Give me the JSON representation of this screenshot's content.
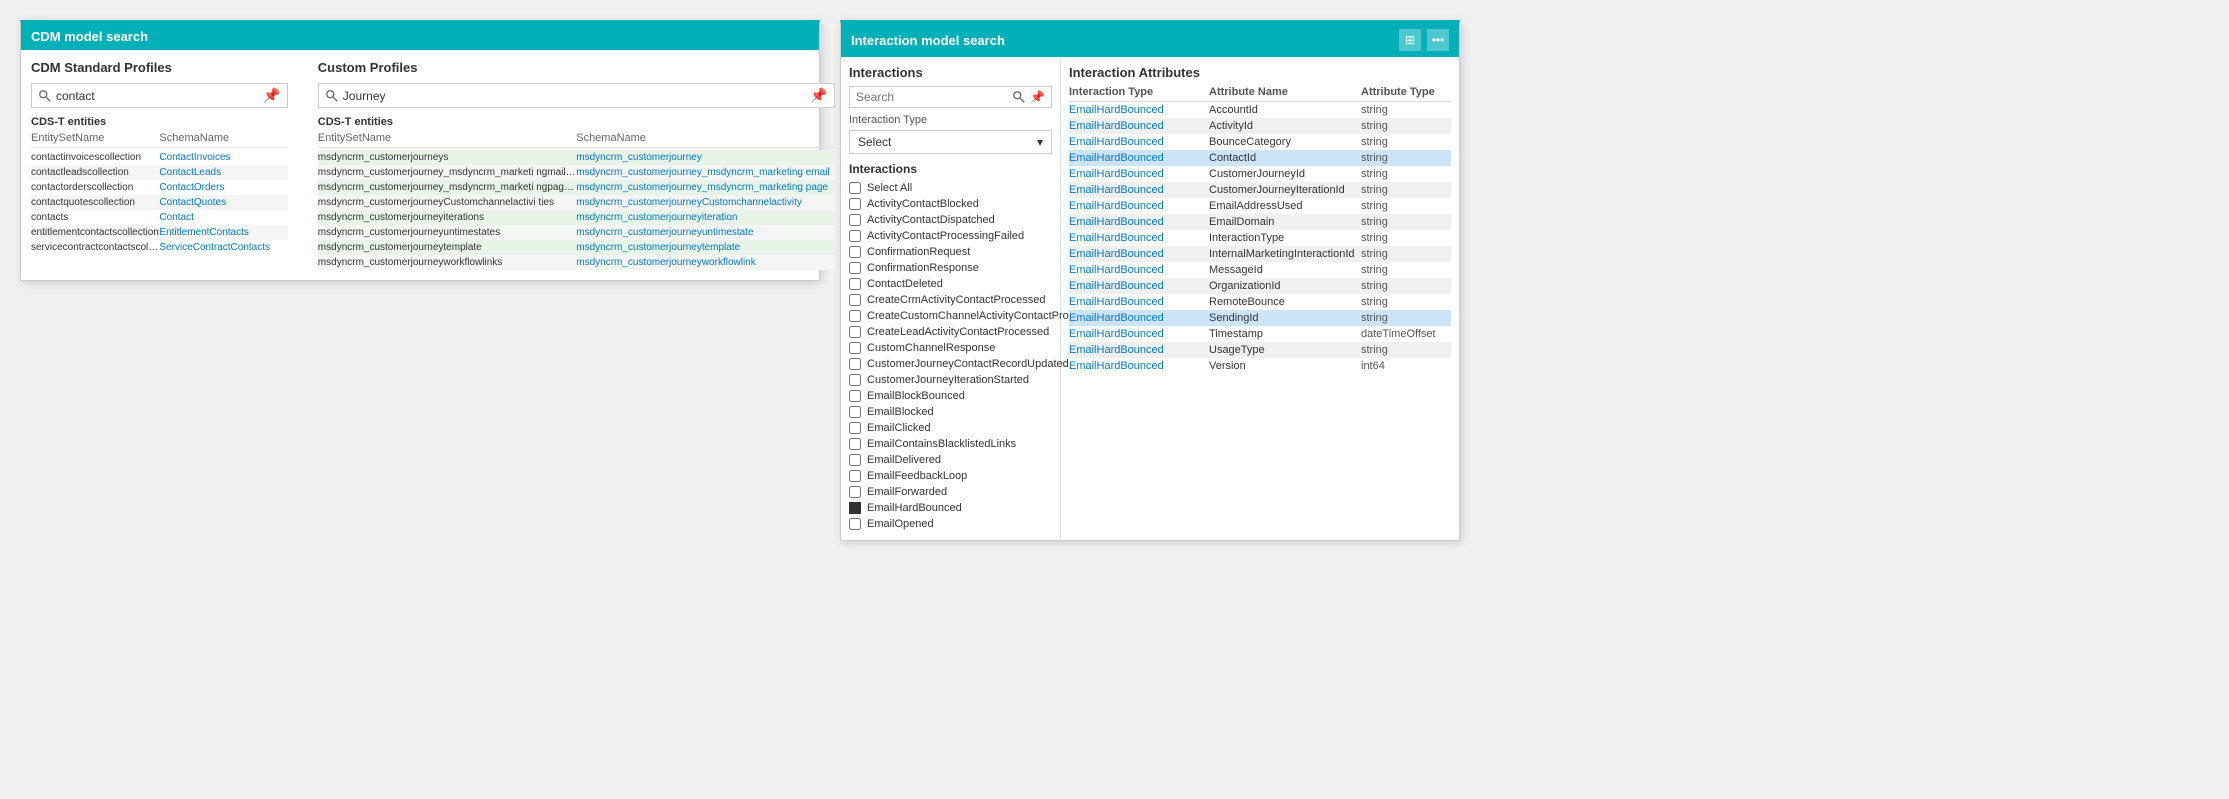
{
  "cdm": {
    "header": "CDM model search",
    "standard_profiles_title": "CDM Standard Profiles",
    "custom_profiles_title": "Custom Profiles",
    "search_placeholder_left": "contact",
    "search_placeholder_right": "Journey",
    "entities_label_left": "CDS-T entities",
    "entities_label_right": "CDS-T entities",
    "col_entity": "EntitySetName",
    "col_schema": "SchemaName",
    "left_rows": [
      {
        "entity": "contactinvoicescollection",
        "schema": "ContactInvoices"
      },
      {
        "entity": "contactleadscollection",
        "schema": "ContactLeads"
      },
      {
        "entity": "contactorderscollection",
        "schema": "ContactOrders"
      },
      {
        "entity": "contactquotescollection",
        "schema": "ContactQuotes"
      },
      {
        "entity": "contacts",
        "schema": "Contact"
      },
      {
        "entity": "entitlementcontactscollection",
        "schema": "EntitlementContacts"
      },
      {
        "entity": "servicecontractcontactscollection",
        "schema": "ServiceContractContacts"
      }
    ],
    "right_rows": [
      {
        "entity": "msdyncrm_customerjourneys",
        "schema": "msdyncrm_customerjourney"
      },
      {
        "entity": "msdyncrm_customerjourney_msdyncrm_marketi ngmailset",
        "schema": "msdyncrm_customerjourney_msdyncrm_marketing email"
      },
      {
        "entity": "msdyncrm_customerjourney_msdyncrm_marketi ngpageset",
        "schema": "msdyncrm_customerjourney_msdyncrm_marketing page"
      },
      {
        "entity": "msdyncrm_customerjourneyCustomchannelactivi ties",
        "schema": "msdyncrm_customerjourneyCustomchannelactivity"
      },
      {
        "entity": "msdyncrm_customerjourneyiterations",
        "schema": "msdyncrm_customerjourneyiteration"
      },
      {
        "entity": "msdyncrm_customerjourneyuntimestates",
        "schema": "msdyncrm_customerjourneyuntimestate"
      },
      {
        "entity": "msdyncrm_customerjourneytemplate",
        "schema": "msdyncrm_customerjourneytemplate"
      },
      {
        "entity": "msdyncrm_customerjourneyworkflowlinks",
        "schema": "msdyncrm_customerjourneyworkflowlink"
      }
    ]
  },
  "interaction": {
    "header": "Interaction model search",
    "interactions_title": "Interactions",
    "search_placeholder": "Search",
    "interaction_type_label": "Interaction Type",
    "select_label": "Select",
    "interactions_list_title": "Interactions",
    "checkboxes": [
      {
        "label": "Select All",
        "checked": false
      },
      {
        "label": "ActivityContactBlocked",
        "checked": false
      },
      {
        "label": "ActivityContactDispatched",
        "checked": false
      },
      {
        "label": "ActivityContactProcessingFailed",
        "checked": false
      },
      {
        "label": "ConfirmationRequest",
        "checked": false
      },
      {
        "label": "ConfirmationResponse",
        "checked": false
      },
      {
        "label": "ContactDeleted",
        "checked": false
      },
      {
        "label": "CreateCrmActivityContactProcessed",
        "checked": false
      },
      {
        "label": "CreateCustomChannelActivityContactProc...",
        "checked": false
      },
      {
        "label": "CreateLeadActivityContactProcessed",
        "checked": false
      },
      {
        "label": "CustomChannelResponse",
        "checked": false
      },
      {
        "label": "CustomerJourneyContactRecordUpdated",
        "checked": false
      },
      {
        "label": "CustomerJourneyIterationStarted",
        "checked": false
      },
      {
        "label": "EmailBlockBounced",
        "checked": false
      },
      {
        "label": "EmailBlocked",
        "checked": false
      },
      {
        "label": "EmailClicked",
        "checked": false
      },
      {
        "label": "EmailContainsBlacklistedLinks",
        "checked": false
      },
      {
        "label": "EmailDelivered",
        "checked": false
      },
      {
        "label": "EmailFeedbackLoop",
        "checked": false
      },
      {
        "label": "EmailForwarded",
        "checked": false
      },
      {
        "label": "EmailHardBounced",
        "checked": true,
        "filled": true
      },
      {
        "label": "EmailOpened",
        "checked": false
      }
    ],
    "attributes_title": "Interaction Attributes",
    "attr_col_type": "Interaction Type",
    "attr_col_name": "Attribute Name",
    "attr_col_atype": "Attribute Type",
    "attribute_rows": [
      {
        "type": "EmailHardBounced",
        "name": "AccountId",
        "atype": "string",
        "highlight": false
      },
      {
        "type": "EmailHardBounced",
        "name": "ActivityId",
        "atype": "string",
        "highlight": false
      },
      {
        "type": "EmailHardBounced",
        "name": "BounceCategory",
        "atype": "string",
        "highlight": false
      },
      {
        "type": "EmailHardBounced",
        "name": "ContactId",
        "atype": "string",
        "highlight": true
      },
      {
        "type": "EmailHardBounced",
        "name": "CustomerJourneyId",
        "atype": "string",
        "highlight": false
      },
      {
        "type": "EmailHardBounced",
        "name": "CustomerJourneyIterationId",
        "atype": "string",
        "highlight": false
      },
      {
        "type": "EmailHardBounced",
        "name": "EmailAddressUsed",
        "atype": "string",
        "highlight": false
      },
      {
        "type": "EmailHardBounced",
        "name": "EmailDomain",
        "atype": "string",
        "highlight": false
      },
      {
        "type": "EmailHardBounced",
        "name": "InteractionType",
        "atype": "string",
        "highlight": false
      },
      {
        "type": "EmailHardBounced",
        "name": "InternalMarketingInteractionId",
        "atype": "string",
        "highlight": false
      },
      {
        "type": "EmailHardBounced",
        "name": "MessageId",
        "atype": "string",
        "highlight": false
      },
      {
        "type": "EmailHardBounced",
        "name": "OrganizationId",
        "atype": "string",
        "highlight": false
      },
      {
        "type": "EmailHardBounced",
        "name": "RemoteBounce",
        "atype": "string",
        "highlight": false
      },
      {
        "type": "EmailHardBounced",
        "name": "SendingId",
        "atype": "string",
        "highlight": true
      },
      {
        "type": "EmailHardBounced",
        "name": "Timestamp",
        "atype": "dateTimeOffset",
        "highlight": false
      },
      {
        "type": "EmailHardBounced",
        "name": "UsageType",
        "atype": "string",
        "highlight": false
      },
      {
        "type": "EmailHardBounced",
        "name": "Version",
        "atype": "int64",
        "highlight": false
      }
    ]
  }
}
